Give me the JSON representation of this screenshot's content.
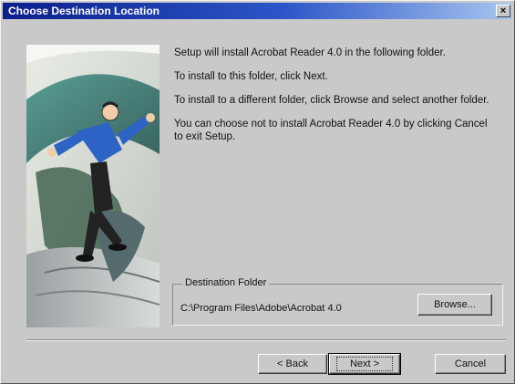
{
  "window": {
    "title": "Choose Destination Location",
    "close_glyph": "×"
  },
  "illustration": {
    "icon": "acrobat-man-illustration"
  },
  "body": {
    "line1": "Setup will install Acrobat Reader 4.0 in the following folder.",
    "line2": "To install to this folder, click Next.",
    "line3": "To install to a different folder, click Browse and select another folder.",
    "line4": "You can choose not to install Acrobat Reader 4.0 by clicking Cancel to exit Setup."
  },
  "destination": {
    "group_label": "Destination Folder",
    "path": "C:\\Program Files\\Adobe\\Acrobat 4.0",
    "browse_label": "Browse..."
  },
  "buttons": {
    "back_label": "< Back",
    "next_label": "Next >",
    "cancel_label": "Cancel"
  },
  "colors": {
    "title_bar_start": "#0b1f8c",
    "title_bar_end": "#a8c6f0",
    "dialog_face": "#c9c9c9"
  }
}
